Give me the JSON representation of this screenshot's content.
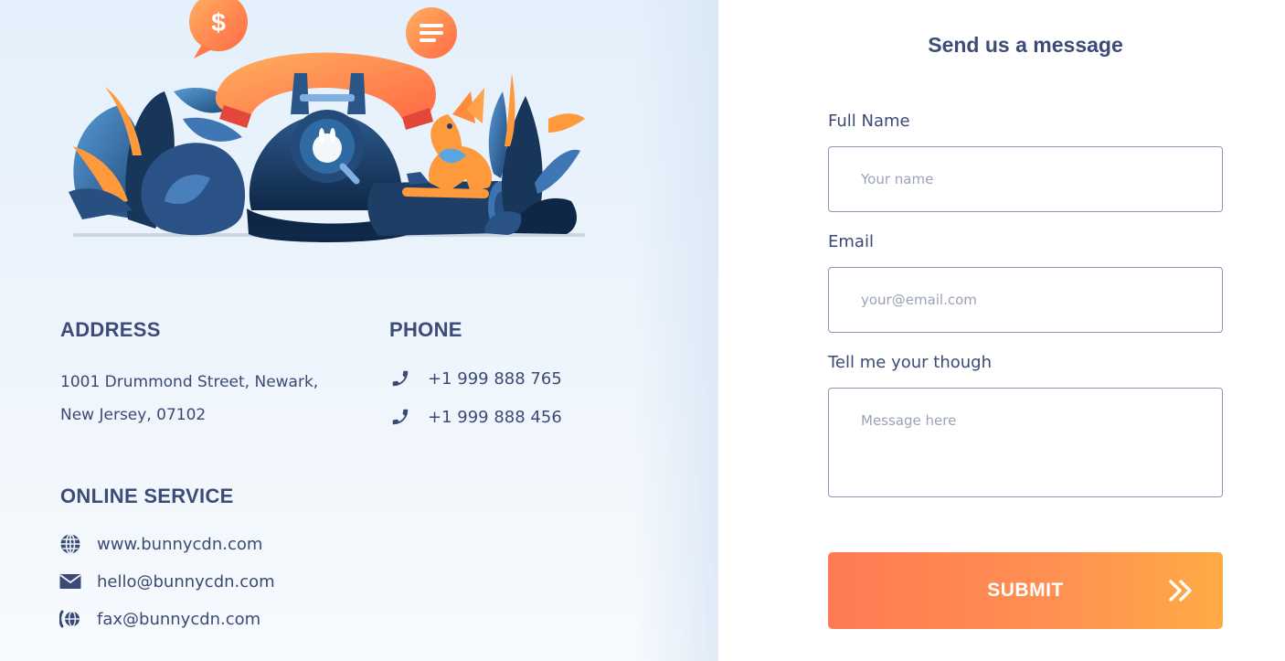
{
  "contact": {
    "address_title": "ADDRESS",
    "address_lines": [
      "1001  Drummond Street, Newark,",
      "New Jersey, 07102"
    ],
    "phone_title": "PHONE",
    "phones": [
      "+1 999 888 765",
      "+1 999 888 456"
    ],
    "online_title": "ONLINE SERVICE",
    "online": [
      {
        "icon": "globe-icon",
        "text": "www.bunnycdn.com"
      },
      {
        "icon": "mail-icon",
        "text": "hello@bunnycdn.com"
      },
      {
        "icon": "fax-icon",
        "text": "fax@bunnycdn.com"
      }
    ]
  },
  "form": {
    "title": "Send us a message",
    "name_label": "Full Name",
    "name_placeholder": "Your name",
    "email_label": "Email",
    "email_placeholder": "your@email.com",
    "message_label": "Tell me your though",
    "message_placeholder": "Message here",
    "submit_label": "SUBMIT"
  },
  "colors": {
    "text_primary": "#3b4a75",
    "accent_orange": "#ff8552",
    "accent_gold": "#ffab45",
    "illustration_blue": "#1d3e66",
    "panel_bg": "#e8f2fc"
  }
}
